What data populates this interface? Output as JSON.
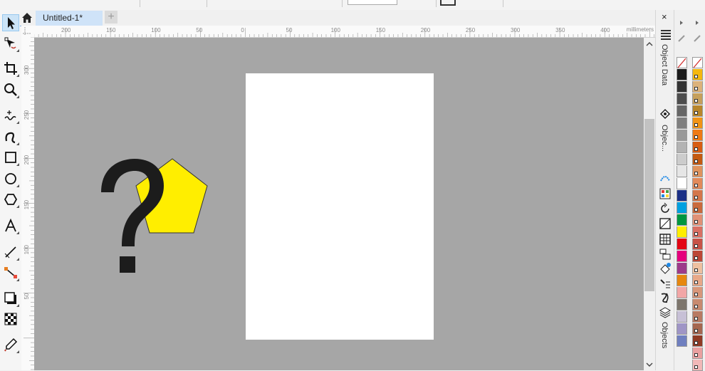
{
  "document": {
    "tab_title": "Untitled-1*",
    "new_tab_symbol": "+"
  },
  "ruler": {
    "unit": "millimeters",
    "horizontal_ticks": [
      "200",
      "150",
      "100",
      "50",
      "0",
      "50",
      "100",
      "150",
      "200",
      "250",
      "300",
      "350",
      "400"
    ],
    "vertical_ticks": [
      "300",
      "250",
      "200",
      "150",
      "100",
      "50"
    ]
  },
  "dockers": {
    "close_symbol": "×",
    "tabs": [
      "Object Data",
      "Objec...",
      "Objects"
    ]
  },
  "toolbox": {
    "tools": [
      "pick-tool",
      "shape-tool",
      "crop-tool",
      "zoom-tool",
      "freehand-tool",
      "artistic-media-tool",
      "rectangle-tool",
      "ellipse-tool",
      "polygon-tool",
      "text-tool",
      "parallel-dimension-tool",
      "connector-tool",
      "drop-shadow-tool",
      "transparency-tool",
      "color-eyedropper-tool"
    ]
  },
  "canvas_objects": {
    "question_mark": {
      "text": "?",
      "fill": "#1c1c1c"
    },
    "pentagon": {
      "fill": "#ffee00",
      "outline": "#333333"
    }
  },
  "colors": {
    "canvas_bg": "#a6a6a6",
    "page_bg": "#ffffff",
    "tab_active": "#cfe3f8",
    "palette_main": [
      "none",
      "#1a1a1a",
      "#333333",
      "#4d4d4d",
      "#666666",
      "#7f7f7f",
      "#999999",
      "#b3b3b3",
      "#cccccc",
      "#e6e6e6",
      "#ffffff",
      "#1b2f86",
      "#00a0e0",
      "#00963f",
      "#ffee00",
      "#e30613",
      "#e5007d",
      "#9d3a8a",
      "#e6870f",
      "#f2a6a6",
      "#7d756c",
      "#c7c0d6",
      "#9f95c6",
      "#6f7fbf"
    ],
    "palette_second": [
      "none",
      "#f5b80f",
      "#dcb27a",
      "#c6a05c",
      "#b8862b",
      "#f19416",
      "#ee7a16",
      "#d75d13",
      "#c45a11",
      "#df935d",
      "#e28a5a",
      "#d4764b",
      "#c96a3d",
      "#e19176",
      "#d97063",
      "#c75247",
      "#bb4736",
      "#eec0a0",
      "#e8a888",
      "#d8977a",
      "#c88a6f",
      "#b87a63",
      "#a56750",
      "#8f3a24",
      "#eaa0a0",
      "#f2b8b8"
    ]
  }
}
